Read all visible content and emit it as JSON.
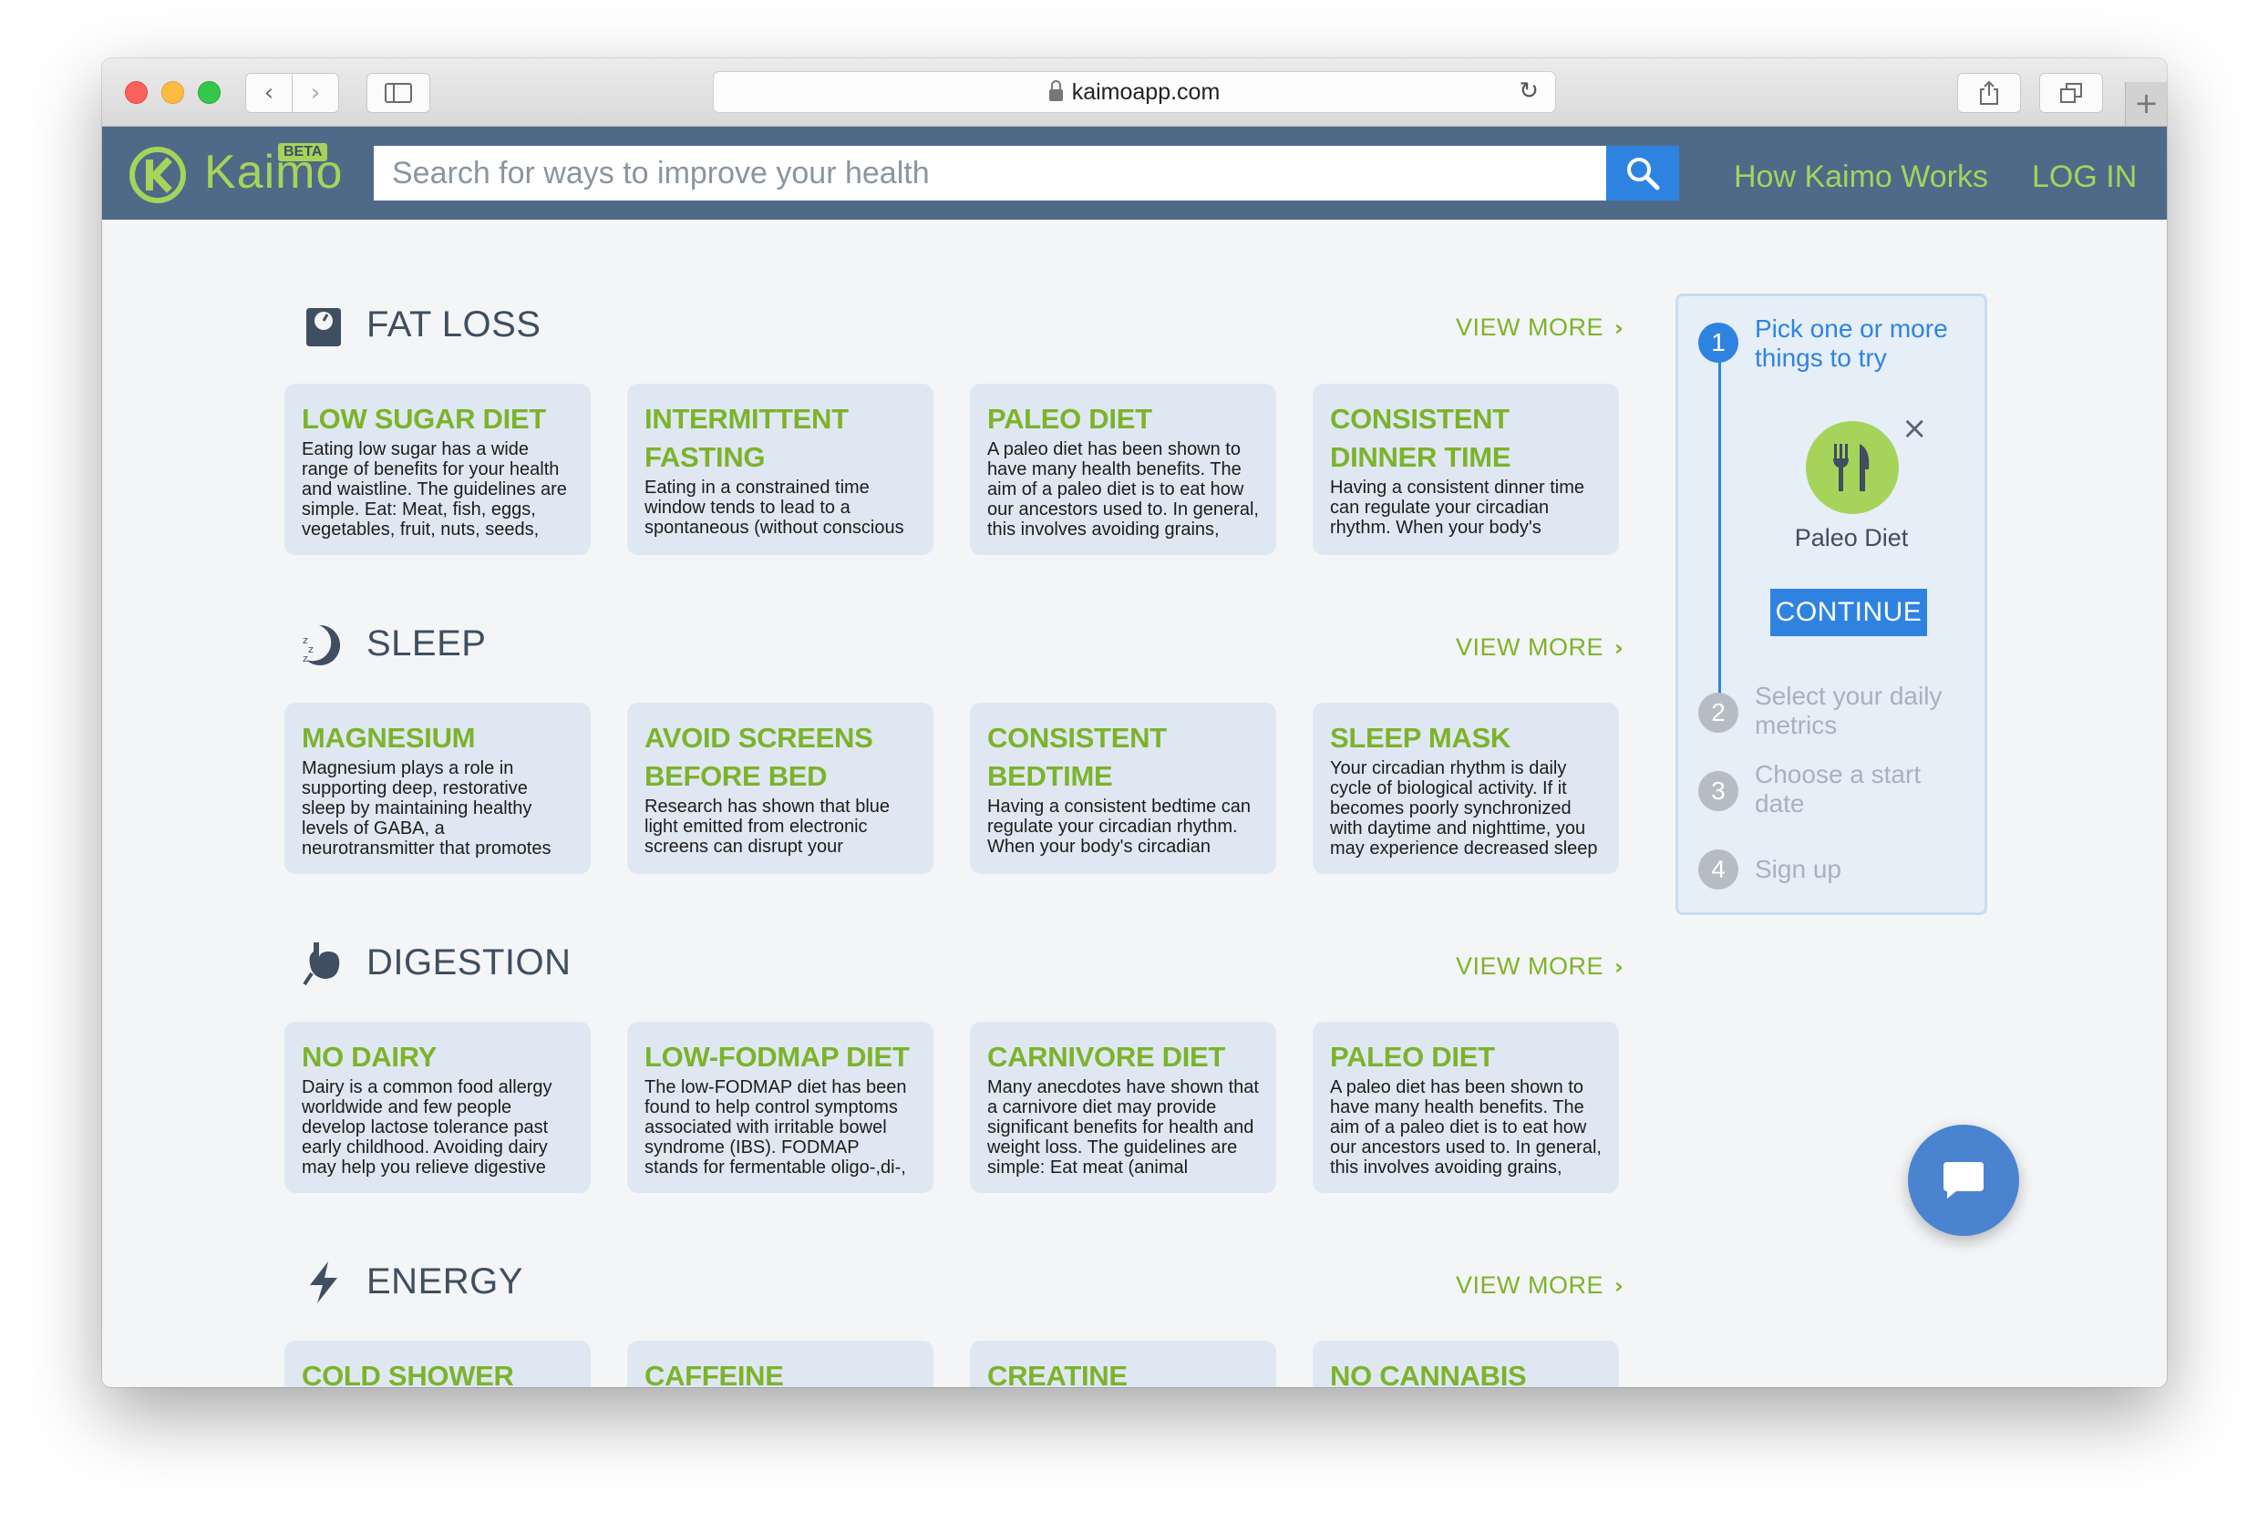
{
  "browser": {
    "url": "kaimoapp.com",
    "reload_icon": "reload-icon",
    "back_icon": "chevron-left-icon",
    "forward_icon": "chevron-right-icon",
    "sidebar_icon": "sidebar-icon",
    "share_icon": "share-icon",
    "tabs_icon": "tabs-icon",
    "newtab_icon": "plus-icon"
  },
  "header": {
    "logo": "Kaimo",
    "beta": "BETA",
    "search_placeholder": "Search for ways to improve your health",
    "nav": [
      "How Kaimo Works",
      "LOG IN"
    ],
    "accent": "#a6d35a",
    "bar_color": "#4e6a88"
  },
  "sections": [
    {
      "title": "FAT LOSS",
      "icon": "scale-icon",
      "view_more": "VIEW MORE",
      "cards": [
        {
          "title": "LOW SUGAR DIET",
          "text": "Eating low sugar has a wide range of benefits for your health and waistline. The guidelines are simple. Eat: Meat, fish, eggs, vegetables, fruit, nuts, seeds,"
        },
        {
          "title": "INTERMITTENT FASTING",
          "text": "Eating in a constrained time window tends to lead to a spontaneous (without conscious"
        },
        {
          "title": "PALEO DIET",
          "text": "A paleo diet has been shown to have many health benefits. The aim of a paleo diet is to eat how our ancestors used to. In general, this involves avoiding grains,"
        },
        {
          "title": "CONSISTENT DINNER TIME",
          "text": "Having a consistent dinner time can regulate your circadian rhythm. When your body's"
        }
      ]
    },
    {
      "title": "SLEEP",
      "icon": "moon-sleep-icon",
      "view_more": "VIEW MORE",
      "cards": [
        {
          "title": "MAGNESIUM",
          "text": "Magnesium plays a role in supporting deep, restorative sleep by maintaining healthy levels of GABA, a neurotransmitter that promotes"
        },
        {
          "title": "AVOID SCREENS BEFORE BED",
          "text": "Research has shown that blue light emitted from electronic screens can disrupt your"
        },
        {
          "title": "CONSISTENT BEDTIME",
          "text": "Having a consistent bedtime can regulate your circadian rhythm. When your body's circadian"
        },
        {
          "title": "SLEEP MASK",
          "text": "Your circadian rhythm is daily cycle of biological activity. If it becomes poorly synchronized with daytime and nighttime, you may experience decreased sleep"
        }
      ]
    },
    {
      "title": "DIGESTION",
      "icon": "stomach-icon",
      "view_more": "VIEW MORE",
      "cards": [
        {
          "title": "NO DAIRY",
          "text": "Dairy is a common food allergy worldwide and few people develop lactose tolerance past early childhood. Avoiding dairy may help you relieve digestive"
        },
        {
          "title": "LOW-FODMAP DIET",
          "text": "The low-FODMAP diet has been found to help control symptoms associated with irritable bowel syndrome (IBS). FODMAP stands for fermentable oligo-,di-,"
        },
        {
          "title": "CARNIVORE DIET",
          "text": "Many anecdotes have shown that a carnivore diet may provide significant benefits for health and weight loss. The guidelines are simple: Eat meat (animal"
        },
        {
          "title": "PALEO DIET",
          "text": "A paleo diet has been shown to have many health benefits. The aim of a paleo diet is to eat how our ancestors used to. In general, this involves avoiding grains,"
        }
      ]
    },
    {
      "title": "ENERGY",
      "icon": "lightning-icon",
      "view_more": "VIEW MORE",
      "cards": [
        {
          "title": "COLD SHOWER",
          "text": ""
        },
        {
          "title": "CAFFEINE",
          "text": ""
        },
        {
          "title": "CREATINE",
          "text": ""
        },
        {
          "title": "NO CANNABIS",
          "text": ""
        }
      ]
    }
  ],
  "steps": {
    "items": [
      {
        "num": "1",
        "label": "Pick one or more things to try",
        "active": true
      },
      {
        "num": "2",
        "label": "Select your daily metrics",
        "active": false
      },
      {
        "num": "3",
        "label": "Choose a start date",
        "active": false
      },
      {
        "num": "4",
        "label": "Sign up",
        "active": false
      }
    ],
    "selected_item": "Paleo Diet",
    "selected_icon": "fork-knife-icon",
    "remove_icon": "close-icon",
    "continue_label": "CONTINUE"
  },
  "chat": {
    "icon": "chat-bubble-icon"
  }
}
